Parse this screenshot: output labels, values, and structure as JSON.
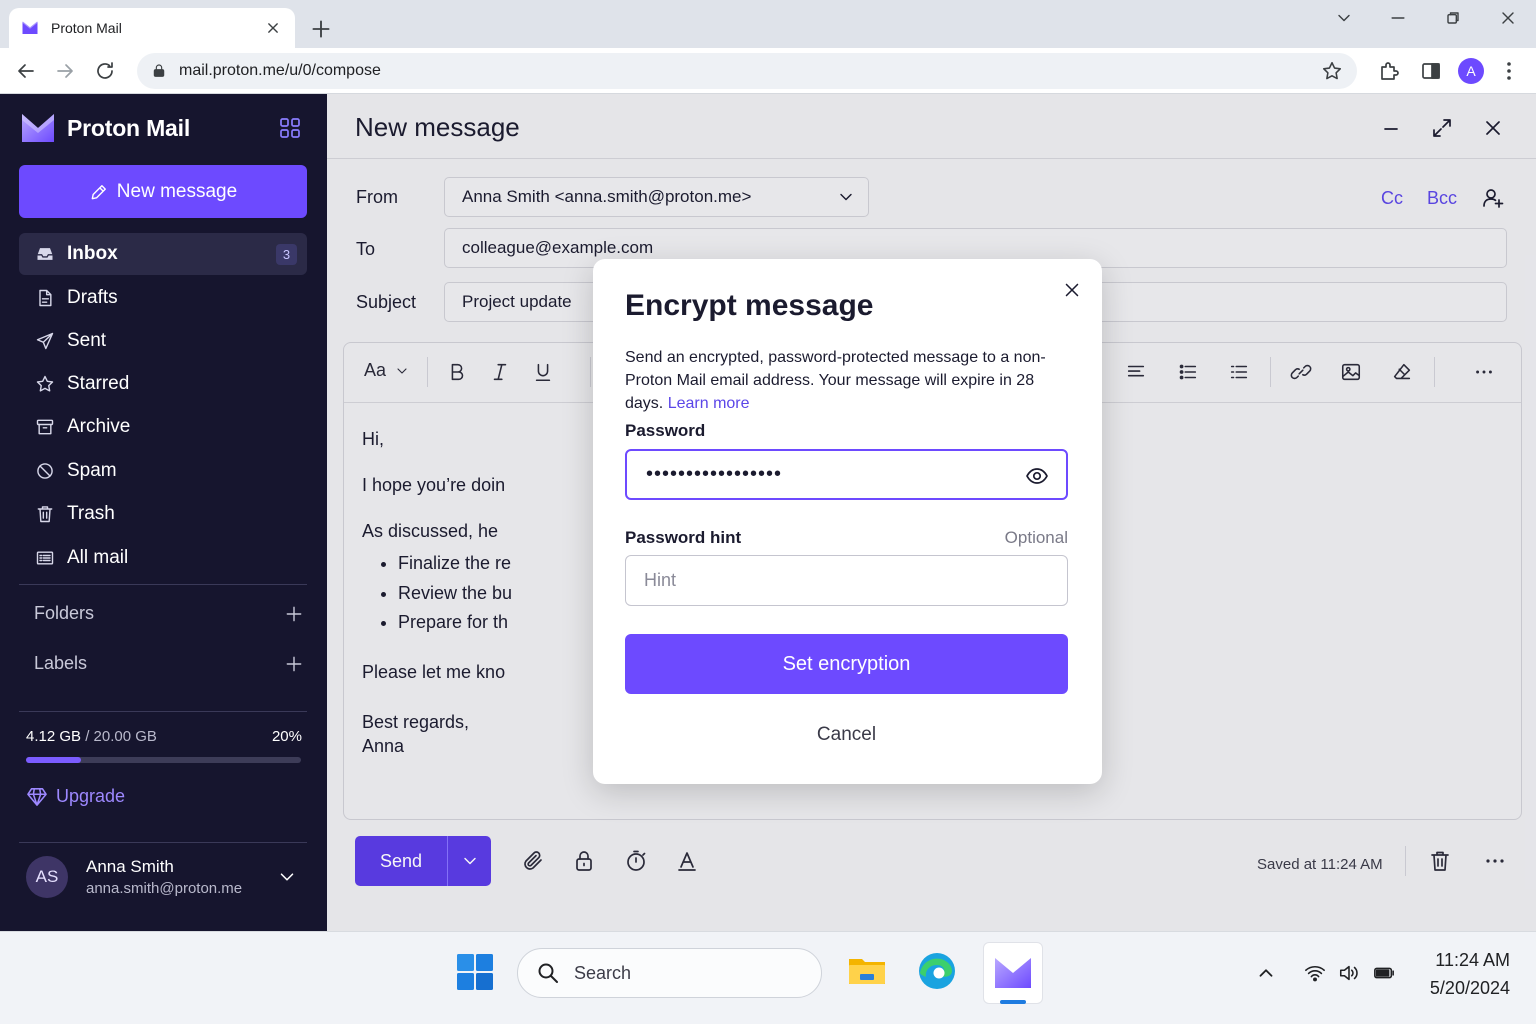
{
  "browser": {
    "tab_title": "Proton Mail",
    "url": "mail.proton.me/u/0/compose",
    "profile_initial": "A"
  },
  "sidebar": {
    "brand": "Proton Mail",
    "new_message_label": "New message",
    "items": [
      {
        "label": "Inbox",
        "icon": "inbox-icon",
        "badge": "3",
        "active": true
      },
      {
        "label": "Drafts",
        "icon": "drafts-icon"
      },
      {
        "label": "Sent",
        "icon": "sent-icon"
      },
      {
        "label": "Starred",
        "icon": "star-icon"
      },
      {
        "label": "Archive",
        "icon": "archive-icon"
      },
      {
        "label": "Spam",
        "icon": "spam-icon"
      },
      {
        "label": "Trash",
        "icon": "trash-icon"
      },
      {
        "label": "All mail",
        "icon": "all-mail-icon"
      }
    ],
    "folders_label": "Folders",
    "labels_label": "Labels",
    "storage": {
      "used": "4.12 GB",
      "total": "/ 20.00 GB",
      "percent_text": "20%",
      "fraction": 0.2
    },
    "upgrade_label": "Upgrade",
    "user": {
      "initials": "AS",
      "name": "Anna Smith",
      "email": "anna.smith@proton.me"
    }
  },
  "composer": {
    "title": "New message",
    "from_label": "From",
    "from_value": "Anna Smith <anna.smith@proton.me>",
    "to_label": "To",
    "to_value": "colleague@example.com",
    "subject_label": "Subject",
    "subject_value": "Project update",
    "cc_label": "Cc",
    "bcc_label": "Bcc",
    "font_label": "Aa",
    "body": {
      "greeting": "Hi,",
      "line1": "I hope you’re doin",
      "line2": "As discussed, he",
      "bullets": [
        "Finalize the re",
        "Review the bu",
        "Prepare for th"
      ],
      "line3": "Please let me kno",
      "closing": "Best regards,",
      "signature": "Anna"
    },
    "send_label": "Send",
    "saved_text": "Saved at 11:24 AM"
  },
  "modal": {
    "title": "Encrypt message",
    "description": "Send an encrypted, password-protected message to a non-Proton Mail email address. Your message will expire in 28 days.",
    "learn_more": "Learn more",
    "password_label": "Password",
    "password_value": "•••••••••••••••••",
    "hint_label": "Password hint",
    "optional_label": "Optional",
    "hint_placeholder": "Hint",
    "set_button": "Set encryption",
    "cancel_button": "Cancel"
  },
  "taskbar": {
    "search_placeholder": "Search",
    "time": "11:24 AM",
    "date": "5/20/2024"
  },
  "colors": {
    "brand": "#6d4aff",
    "sidebar_bg": "#16152e",
    "link": "#5b46e8"
  }
}
